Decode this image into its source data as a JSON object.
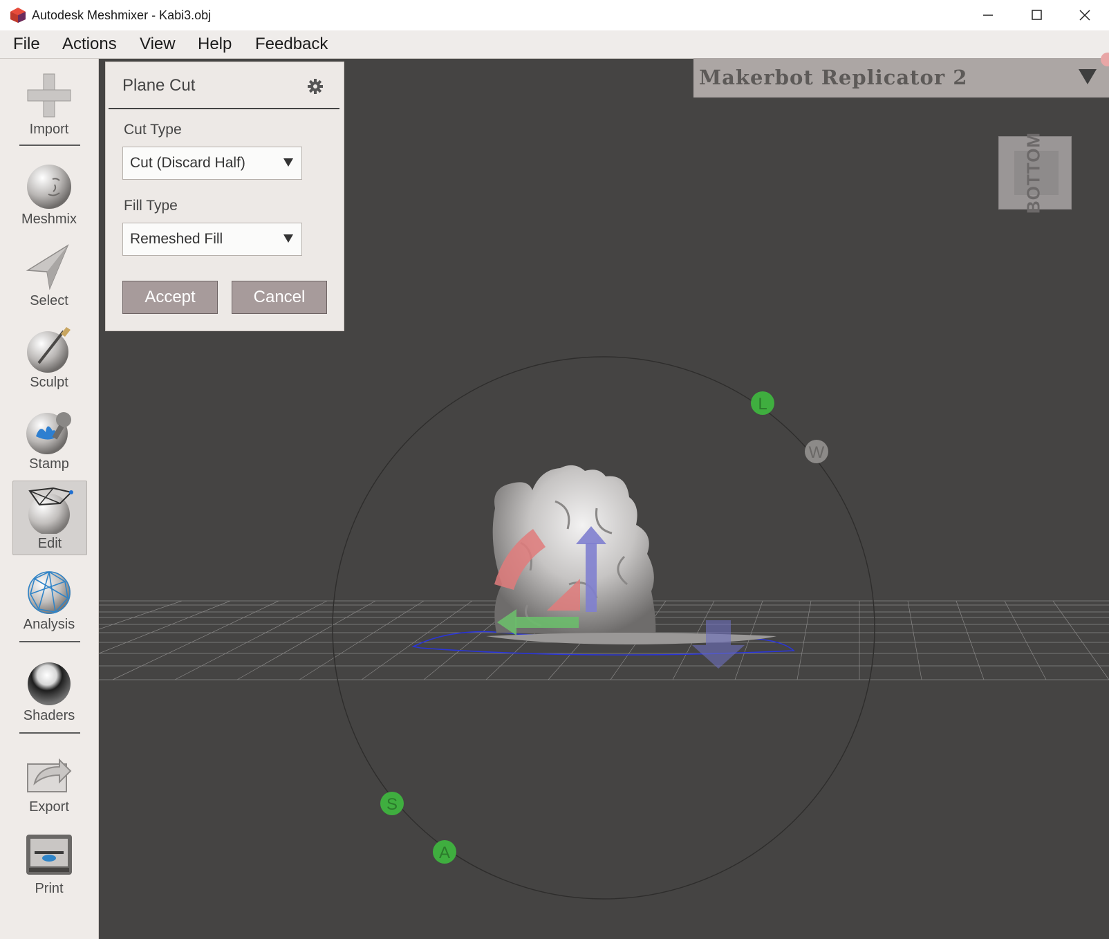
{
  "window": {
    "title": "Autodesk Meshmixer - Kabi3.obj"
  },
  "menu": [
    "File",
    "Actions",
    "View",
    "Help",
    "Feedback"
  ],
  "toolbar": {
    "items": [
      {
        "label": "Import",
        "icon": "plus-icon"
      },
      {
        "label": "Meshmix",
        "icon": "face-sphere-icon"
      },
      {
        "label": "Select",
        "icon": "cursor-arrow-icon"
      },
      {
        "label": "Sculpt",
        "icon": "brush-sphere-icon"
      },
      {
        "label": "Stamp",
        "icon": "stamp-sphere-icon"
      },
      {
        "label": "Edit",
        "icon": "wireframe-sphere-icon"
      },
      {
        "label": "Analysis",
        "icon": "mesh-sphere-icon"
      },
      {
        "label": "Shaders",
        "icon": "chrome-sphere-icon"
      },
      {
        "label": "Export",
        "icon": "export-arrow-icon"
      },
      {
        "label": "Print",
        "icon": "printer-icon"
      }
    ],
    "active": "Edit"
  },
  "panel": {
    "title": "Plane Cut",
    "cut_type_label": "Cut Type",
    "cut_type_value": "Cut (Discard Half)",
    "fill_type_label": "Fill Type",
    "fill_type_value": "Remeshed Fill",
    "accept_label": "Accept",
    "cancel_label": "Cancel"
  },
  "printer": {
    "name": "Makerbot Replicator 2"
  },
  "viewcube": {
    "face": "BOTTOM"
  },
  "gizmo": {
    "markers": [
      "L",
      "W",
      "S",
      "A"
    ]
  },
  "colors": {
    "viewport_bg": "#454443",
    "panel_bg": "#ede9e6",
    "button_bg": "#a79b9b",
    "marker_green": "#3fae3f",
    "marker_gray": "#8c8a88"
  }
}
